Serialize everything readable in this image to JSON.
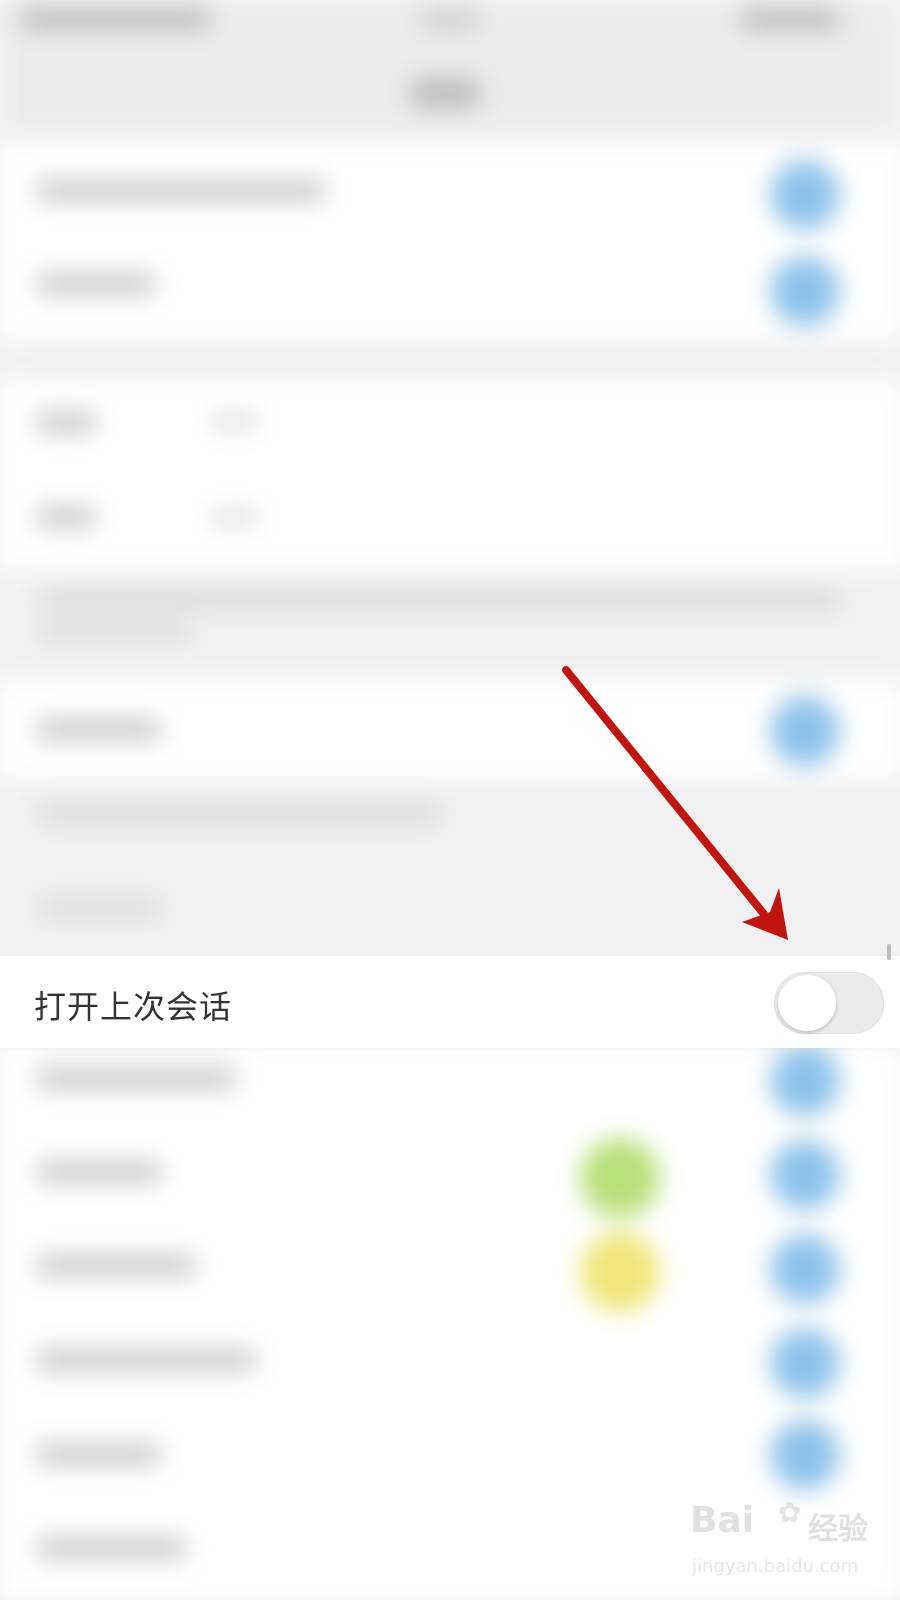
{
  "setting_row": {
    "label": "打开上次会话",
    "toggle_state": "off"
  },
  "watermark": {
    "brand": "Bai",
    "brand_suffix": "经验",
    "url": "jingyan.baidu.com"
  },
  "colors": {
    "annotation_arrow": "#c0150f",
    "toggle_off_track": "#ebebeb",
    "blurred_toggle": "#8fc3ea"
  }
}
